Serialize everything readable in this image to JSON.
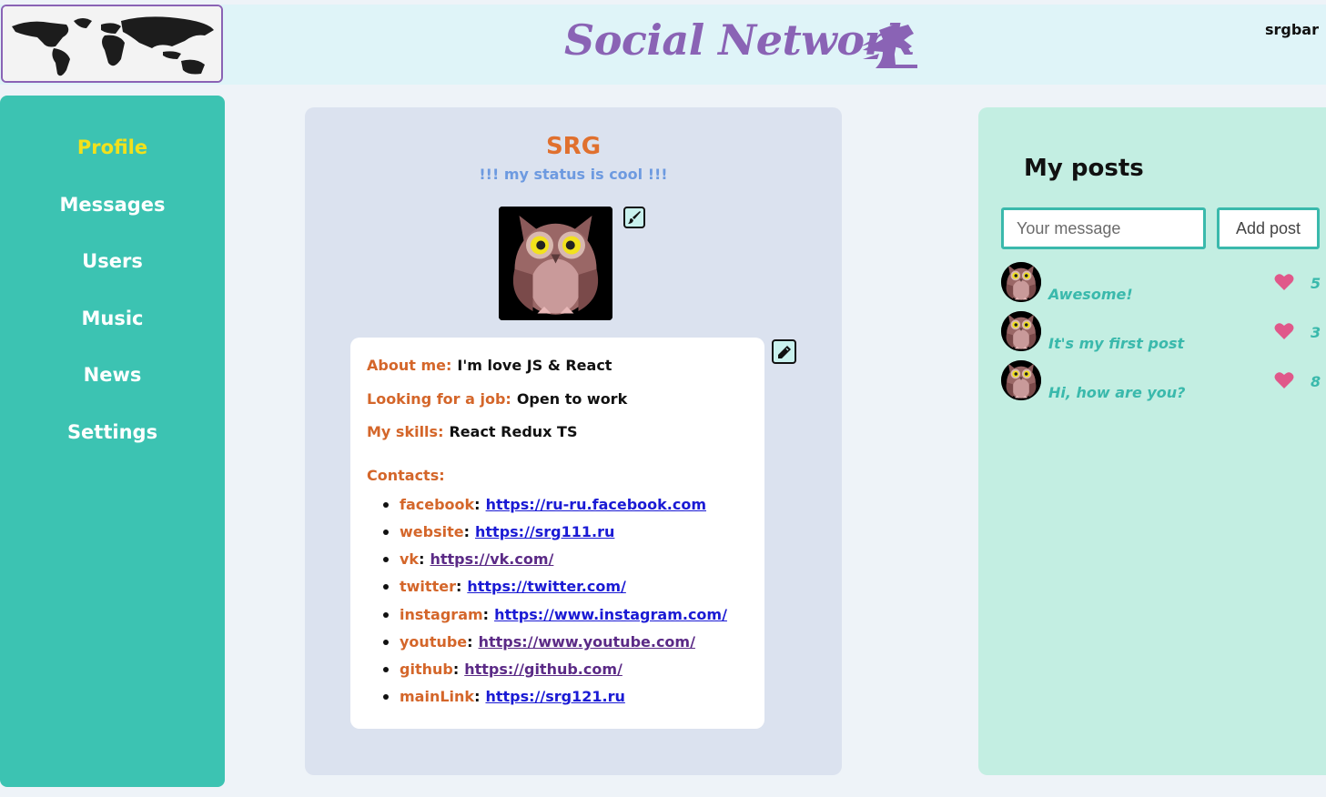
{
  "header": {
    "title": "Social Network",
    "logo_icon": "world-map",
    "title_icon": "dragon-icon",
    "login": "srgbar"
  },
  "sidebar": {
    "items": [
      {
        "label": "Profile",
        "active": true
      },
      {
        "label": "Messages"
      },
      {
        "label": "Users"
      },
      {
        "label": "Music"
      },
      {
        "label": "News"
      },
      {
        "label": "Settings"
      }
    ]
  },
  "profile": {
    "name": "SRG",
    "status": "!!! my status is cool !!!",
    "avatar_icon": "owl-icon",
    "about_label": "About me:",
    "about_value": "I'm love JS & React",
    "job_label": "Looking for a job:",
    "job_value": "Open to work",
    "skills_label": "My skills:",
    "skills_value": "React Redux TS",
    "contacts_title": "Contacts:",
    "contacts": [
      {
        "key": "facebook",
        "url": "https://ru-ru.facebook.com"
      },
      {
        "key": "website",
        "url": "https://srg111.ru"
      },
      {
        "key": "vk",
        "url": "https://vk.com/"
      },
      {
        "key": "twitter",
        "url": "https://twitter.com/"
      },
      {
        "key": "instagram",
        "url": "https://www.instagram.com/"
      },
      {
        "key": "youtube",
        "url": "https://www.youtube.com/"
      },
      {
        "key": "github",
        "url": "https://github.com/"
      },
      {
        "key": "mainLink",
        "url": "https://srg121.ru"
      }
    ]
  },
  "posts": {
    "title": "My posts",
    "input_placeholder": "Your message",
    "add_button": "Add post",
    "items": [
      {
        "text": "Awesome!",
        "likes": "5"
      },
      {
        "text": "It's my first post",
        "likes": "3"
      },
      {
        "text": "Hi, how are you?",
        "likes": "8"
      }
    ]
  },
  "colors": {
    "accent": "#8a63b5",
    "sidebar": "#3cc3b2",
    "active_nav": "#f2e11b",
    "profile_name": "#e0702e",
    "status": "#6d9ae0",
    "post_text": "#3ab9ac",
    "heart": "#e0588a"
  }
}
